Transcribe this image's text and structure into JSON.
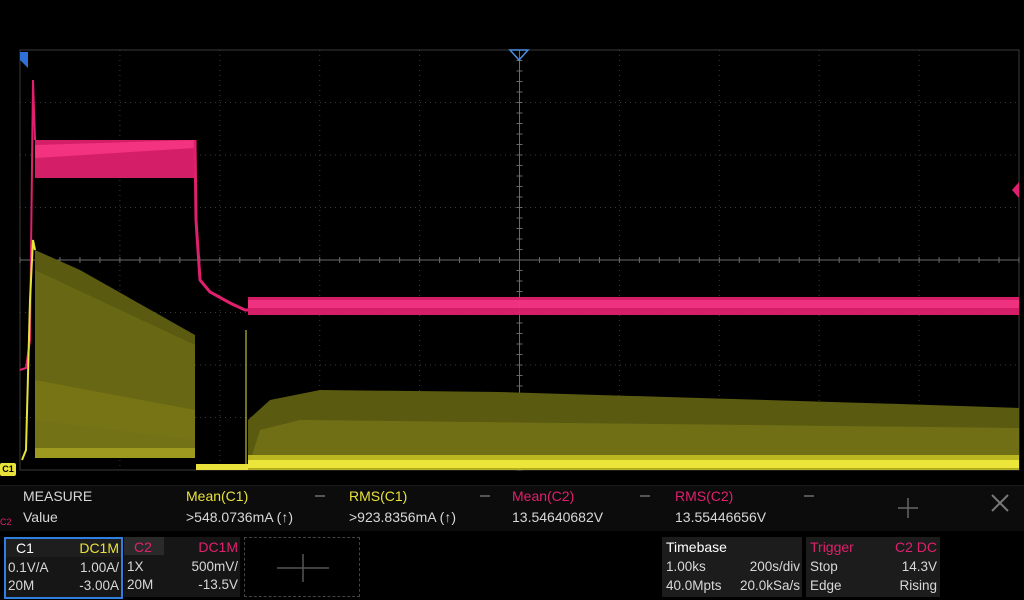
{
  "markers": {
    "c1_label": "C1",
    "c2_label": "C2"
  },
  "measure": {
    "title": "MEASURE",
    "row_label": "Value",
    "columns": [
      {
        "header": "Mean(C1)",
        "value": ">548.0736mA (↑)",
        "color": "#e8e23a"
      },
      {
        "header": "RMS(C1)",
        "value": ">923.8356mA (↑)",
        "color": "#e8e23a"
      },
      {
        "header": "Mean(C2)",
        "value": "13.54640682V",
        "color": "#e0206e"
      },
      {
        "header": "RMS(C2)",
        "value": "13.55446656V",
        "color": "#e0206e"
      }
    ]
  },
  "channel1": {
    "name": "C1",
    "coupling": "DC1M",
    "scale_probe": "0.1V/A",
    "volts_div": "1.00A/",
    "bandwidth": "20M",
    "offset": "-3.00A",
    "color": "#e8e23a"
  },
  "channel2": {
    "name": "C2",
    "coupling": "DC1M",
    "probe": "1X",
    "volts_div": "500mV/",
    "bandwidth": "20M",
    "offset": "-13.5V",
    "color": "#e0206e"
  },
  "timebase": {
    "label": "Timebase",
    "delay": "1.00ks",
    "scale": "200s/div",
    "memory": "40.0Mpts",
    "sample_rate": "20.0kSa/s"
  },
  "trigger": {
    "label": "Trigger",
    "source": "C2 DC",
    "state": "Stop",
    "level": "14.3V",
    "type": "Edge",
    "slope": "Rising"
  }
}
